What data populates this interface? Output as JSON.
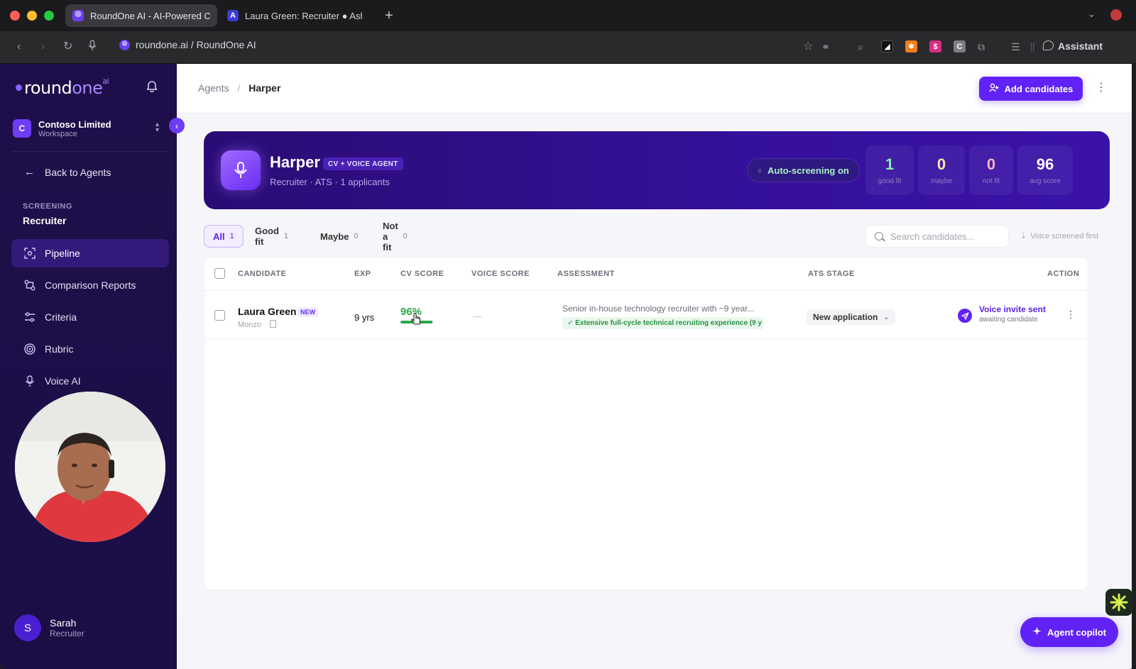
{
  "browser": {
    "tabs": [
      {
        "title": "RoundOne AI - AI-Powered C",
        "active": true
      },
      {
        "title": "Laura Green: Recruiter ● Ash",
        "active": false
      }
    ],
    "new_tab": "+",
    "url": "roundone.ai / RoundOne AI",
    "assistant_label": "Assistant"
  },
  "sidebar": {
    "logo": {
      "round": "round",
      "one": "one",
      "ai": "ai"
    },
    "workspace": {
      "badge": "C",
      "name": "Contoso Limited",
      "sub": "Workspace"
    },
    "back_label": "Back to Agents",
    "section_label": "SCREENING",
    "section_title": "Recruiter",
    "nav": [
      {
        "label": "Pipeline",
        "icon": "pipeline-icon",
        "active": true
      },
      {
        "label": "Comparison Reports",
        "icon": "comparison-icon",
        "active": false
      },
      {
        "label": "Criteria",
        "icon": "criteria-icon",
        "active": false
      },
      {
        "label": "Rubric",
        "icon": "rubric-icon",
        "active": false
      },
      {
        "label": "Voice AI",
        "icon": "mic-icon",
        "active": false
      }
    ],
    "user": {
      "initial": "S",
      "name": "Sarah",
      "role": "Recruiter"
    }
  },
  "header": {
    "breadcrumb": {
      "parent": "Agents",
      "separator": "/",
      "current": "Harper"
    },
    "add_candidates": "Add candidates"
  },
  "agent": {
    "name": "Harper",
    "badge": "CV + VOICE AGENT",
    "subtitle": "Recruiter · ATS · 1 applicants",
    "auto_screening": "Auto-screening on",
    "stats": [
      {
        "value": "1",
        "label": "good fit",
        "color": "#7ff0b5"
      },
      {
        "value": "0",
        "label": "maybe",
        "color": "#ffe6a8"
      },
      {
        "value": "0",
        "label": "not fit",
        "color": "#ffb3b3"
      },
      {
        "value": "96",
        "label": "avg score",
        "color": "#ffffff"
      }
    ]
  },
  "filters": [
    {
      "label": "All",
      "count": "1",
      "active": true
    },
    {
      "label": "Good fit",
      "count": "1",
      "active": false
    },
    {
      "label": "Maybe",
      "count": "0",
      "active": false
    },
    {
      "label": "Not a fit",
      "count": "0",
      "active": false
    }
  ],
  "search": {
    "placeholder": "Search candidates..."
  },
  "sort_label": "Voice screened first",
  "table": {
    "columns": [
      "CANDIDATE",
      "EXP",
      "CV SCORE",
      "VOICE SCORE",
      "ASSESSMENT",
      "ATS STAGE",
      "ACTION"
    ],
    "rows": [
      {
        "name": "Laura Green",
        "badge": "NEW",
        "company": "Monzo",
        "exp": "9 yrs",
        "cv_score": "96%",
        "cv_score_value": 0.96,
        "voice_score": "—",
        "assessment": "Senior in-house technology recruiter with ~9 year...",
        "assessment_tag": "✓ Extensive full-cycle technical recruiting experience (9 y",
        "ats_stage": "New application",
        "action_title": "Voice invite sent",
        "action_sub": "awaiting candidate"
      }
    ]
  },
  "copilot_label": "Agent copilot",
  "colors": {
    "accent": "#6123f5",
    "sidebar": "#1e0f4a",
    "hero": "#2a0c74",
    "good": "#2aa84a"
  }
}
